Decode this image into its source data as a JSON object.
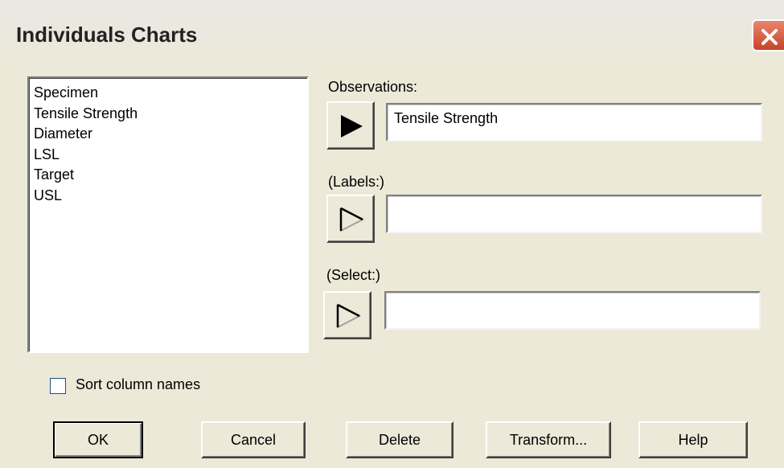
{
  "window": {
    "title": "Individuals Charts"
  },
  "variables": [
    "Specimen",
    "Tensile Strength",
    "Diameter",
    "LSL",
    "Target",
    "USL"
  ],
  "fields": {
    "observations": {
      "label": "Observations:",
      "value": "Tensile Strength",
      "arrow": "filled"
    },
    "labels": {
      "label": "(Labels:)",
      "value": "",
      "arrow": "outline"
    },
    "select": {
      "label": "(Select:)",
      "value": "",
      "arrow": "outline"
    }
  },
  "sort": {
    "label": "Sort column names",
    "checked": false
  },
  "buttons": {
    "ok": "OK",
    "cancel": "Cancel",
    "delete": "Delete",
    "transform": "Transform...",
    "help": "Help"
  },
  "icons": {
    "close": "close-icon",
    "arrow_filled": "play-filled-icon",
    "arrow_outline": "play-outline-icon"
  },
  "colors": {
    "dialog_bg": "#ece9d8",
    "close_button": "#c5452a"
  }
}
